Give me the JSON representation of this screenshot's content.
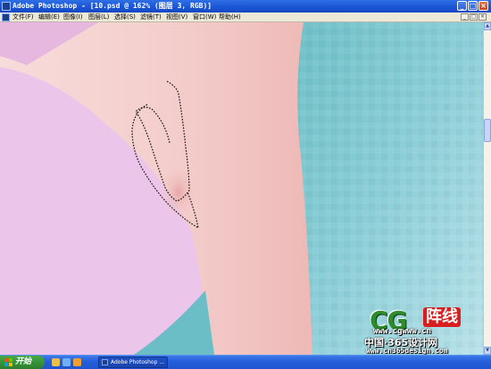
{
  "window": {
    "title": "Adobe Photoshop - [10.psd @ 162% (图层 3, RGB)]",
    "buttons": {
      "minimize": "_",
      "maximize": "□",
      "close": "×"
    }
  },
  "menu": {
    "items": [
      "文件(F)",
      "编辑(E)",
      "图像(I)",
      "图层(L)",
      "选择(S)",
      "滤镜(T)",
      "视图(V)",
      "窗口(W)",
      "帮助(H)"
    ]
  },
  "watermark": {
    "logo_text": "CG",
    "badge_text": "阵线",
    "url_small": "www.cgwww.cn",
    "site_cn": "中国·365设计网",
    "url": "www.cn365design.com"
  },
  "taskbar": {
    "start_label": "开始",
    "task_label": "Adobe Photoshop ..."
  },
  "colors": {
    "titlebar": "#1a54d3",
    "skin": "#f3cfcd",
    "background_pink": "#e9c3e6",
    "background_teal": "#7cc6cf",
    "start_green": "#379237"
  }
}
